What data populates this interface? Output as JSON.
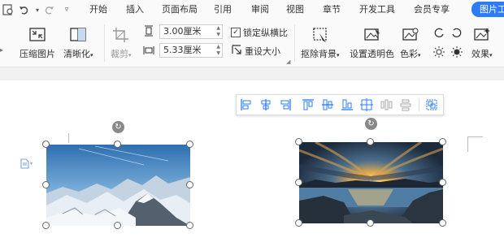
{
  "tabs": [
    "开始",
    "插入",
    "页面布局",
    "引用",
    "审阅",
    "视图",
    "章节",
    "开发工具",
    "会员专享"
  ],
  "active_tab": "图片工具",
  "accent_color": "#2d7cf6",
  "ribbon": {
    "compress": "压缩图片",
    "sharpen": "清晰化",
    "crop": "裁剪",
    "height_value": "3.00厘米",
    "width_value": "5.33厘米",
    "lock_ratio": "锁定纵横比",
    "reset_size": "重设大小",
    "remove_bg": "抠除背景",
    "transparent": "设置透明色",
    "color": "色彩",
    "effects": "效果"
  }
}
